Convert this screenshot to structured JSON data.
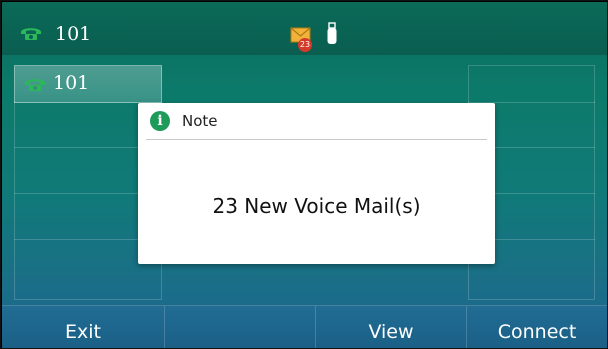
{
  "status_bar": {
    "account_label": "101",
    "voicemail_count": "23",
    "icons": [
      "phone-handset-icon",
      "voicemail-envelope-icon",
      "usb-icon"
    ]
  },
  "line_keys": [
    {
      "label": "101",
      "icon": "phone-handset-icon",
      "active": true
    }
  ],
  "dialog": {
    "title": "Note",
    "message": "23 New Voice Mail(s)",
    "icon": "info-icon"
  },
  "softkeys": [
    {
      "label": "Exit"
    },
    {
      "label": ""
    },
    {
      "label": "View"
    },
    {
      "label": "Connect"
    }
  ],
  "colors": {
    "phone_icon": "#2bb85a",
    "info_icon": "#1e9a5a",
    "badge": "#d43a2a"
  }
}
